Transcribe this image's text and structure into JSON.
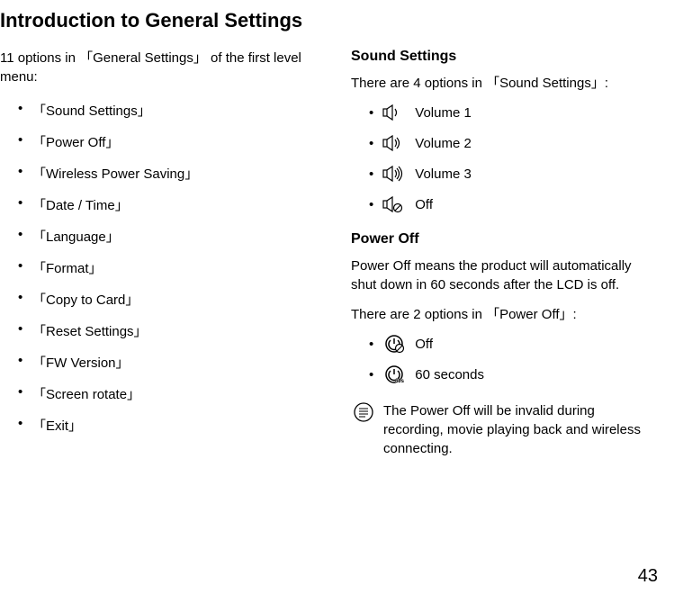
{
  "page_title": "Introduction to General Settings",
  "intro": "11 options in 「General Settings」 of the first level menu:",
  "options": [
    "「Sound Settings」",
    "「Power Off」",
    "「Wireless Power Saving」",
    "「Date / Time」",
    "「Language」",
    "「Format」",
    "「Copy to Card」",
    "「Reset Settings」",
    "「FW Version」",
    "「Screen rotate」",
    "「Exit」"
  ],
  "sound_settings": {
    "heading": "Sound Settings",
    "intro": "There are 4 options in 「Sound Settings」:",
    "items": [
      {
        "icon": "volume-1-icon",
        "label": "Volume 1"
      },
      {
        "icon": "volume-2-icon",
        "label": "Volume 2"
      },
      {
        "icon": "volume-3-icon",
        "label": "Volume 3"
      },
      {
        "icon": "volume-off-icon",
        "label": "Off"
      }
    ]
  },
  "power_off": {
    "heading": "Power Off",
    "description": "Power Off means the product will automatically shut down in 60 seconds after the LCD is off.",
    "intro": "There are 2 options in 「Power Off」:",
    "items": [
      {
        "icon": "power-off-icon",
        "label": "Off"
      },
      {
        "icon": "power-60s-icon",
        "label": "60 seconds"
      }
    ],
    "note": "The Power Off will be invalid during recording, movie playing back and wireless connecting."
  },
  "page_number": "43"
}
